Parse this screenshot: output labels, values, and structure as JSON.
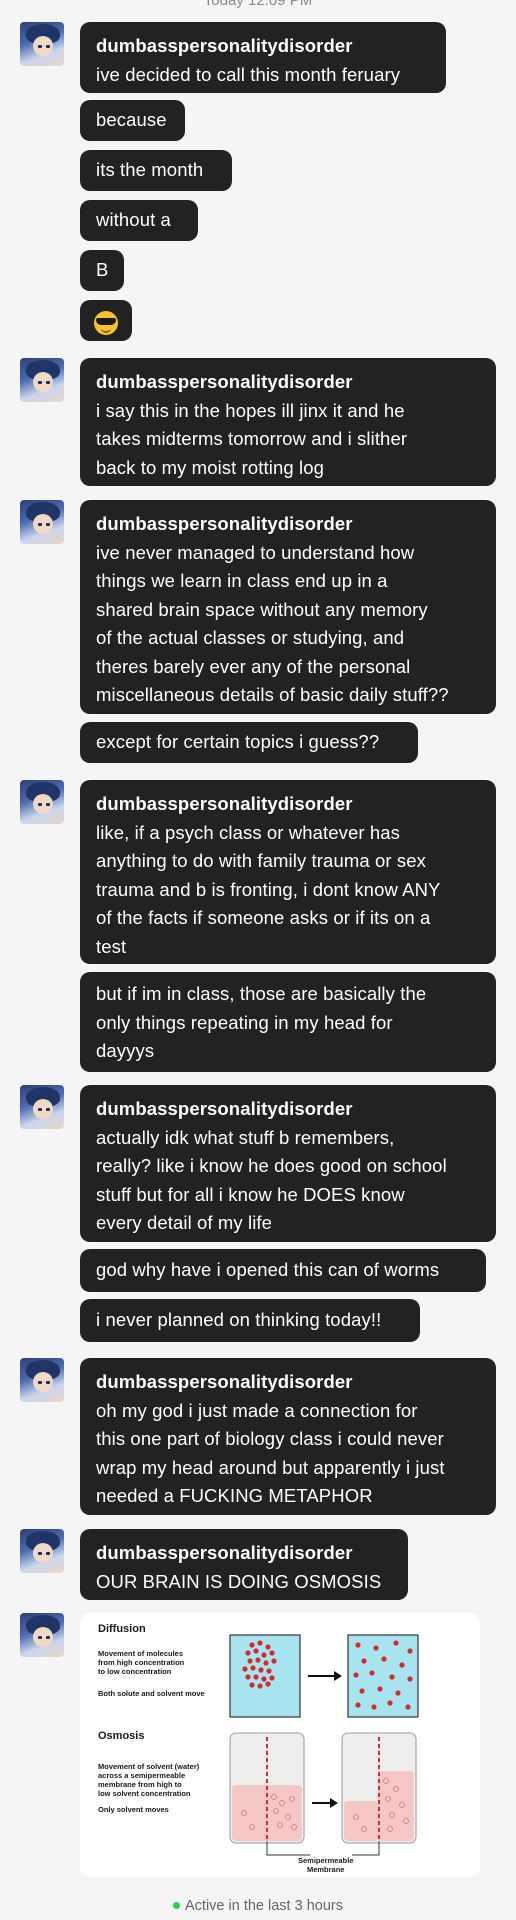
{
  "header": {
    "timestamp": "Today 12:09 PM"
  },
  "username": "dumbasspersonalitydisorder",
  "messages": [
    {
      "lines": [
        "ive decided to call this month feruary"
      ],
      "followups": [
        [
          "because"
        ],
        [
          "its the month"
        ],
        [
          "without a"
        ],
        [
          "B"
        ],
        [
          "emoji:sunglasses"
        ]
      ]
    },
    {
      "lines": [
        "i say this in the hopes ill jinx it and he",
        "takes midterms tomorrow and i slither",
        "back to my moist rotting log"
      ]
    },
    {
      "lines": [
        "ive never managed to understand how",
        "things we learn in class end up in a",
        "shared brain space without any memory",
        "of the actual classes or studying, and",
        "theres barely ever any of the personal",
        "miscellaneous details of basic daily stuff??"
      ],
      "followups": [
        [
          "except for certain topics i guess??"
        ]
      ]
    },
    {
      "lines": [
        "like, if a psych class or whatever has",
        "anything to do with family trauma or sex",
        "trauma and b is fronting, i dont know ANY",
        "of the facts if someone asks or if its on a",
        "test"
      ],
      "followups": [
        [
          "but if im in class, those are basically the",
          "only things repeating in my head for",
          "dayyys"
        ]
      ]
    },
    {
      "lines": [
        "actually idk what stuff b remembers,",
        "really? like i know he does good on school",
        "stuff but for all i know he DOES know",
        "every detail of my life"
      ],
      "followups": [
        [
          "god why have i opened this can of worms"
        ],
        [
          "i never planned on thinking today!!"
        ]
      ]
    },
    {
      "lines": [
        "oh my god i just made a connection for",
        "this one part of biology class i could never",
        "wrap my head around but apparently i just",
        "needed a FUCKING METAPHOR"
      ]
    },
    {
      "lines": [
        "OUR BRAIN IS DOING OSMOSIS"
      ]
    }
  ],
  "diagram": {
    "diffusion_title": "Diffusion",
    "diffusion_desc": [
      "Movement of molecules",
      "from high concentration",
      "to low concentration"
    ],
    "diffusion_note": "Both solute and solvent move",
    "osmosis_title": "Osmosis",
    "osmosis_desc": [
      "Movement of solvent (water)",
      "across a semipermeable",
      "membrane from high to",
      "low solvent concentration"
    ],
    "osmosis_note": "Only solvent moves",
    "membrane_label": [
      "Semipermeable",
      "Membrane"
    ]
  },
  "status": {
    "text": "Active in the last 3 hours",
    "dot_color": "#2ecc4a"
  },
  "colors": {
    "bubble_bg": "#222222",
    "page_bg": "#f5f5f5",
    "bubble_text": "#ffffff"
  }
}
